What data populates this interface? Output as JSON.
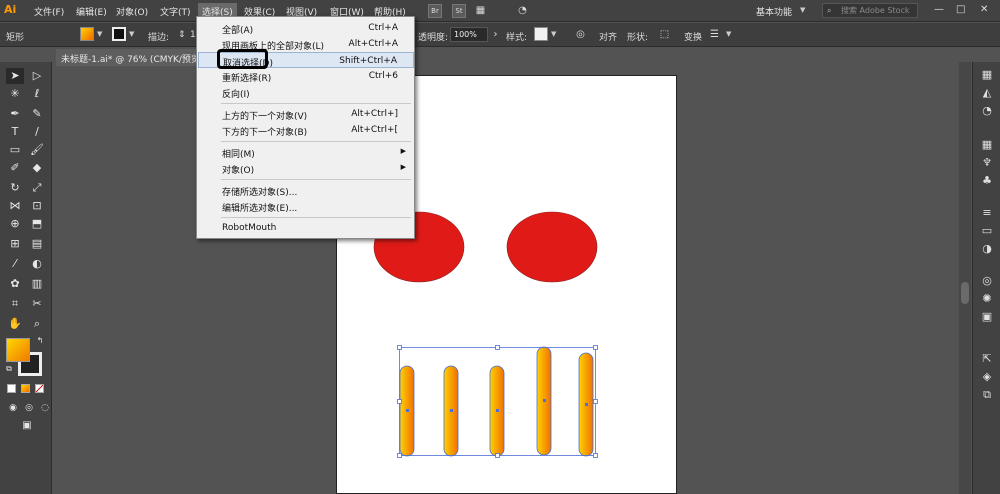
{
  "app": {
    "logo": "Ai",
    "workspace": "基本功能",
    "search_placeholder": "搜索 Adobe Stock"
  },
  "menubar": {
    "items": [
      "文件(F)",
      "编辑(E)",
      "对象(O)",
      "文字(T)",
      "选择(S)",
      "效果(C)",
      "视图(V)",
      "窗口(W)",
      "帮助(H)"
    ],
    "icons": [
      "Br",
      "St"
    ]
  },
  "control": {
    "tool_name": "矩形",
    "stroke_label": "描边:",
    "stroke_value": "1",
    "opacity_label": "透明度:",
    "opacity_value": "100%",
    "style_label": "样式:",
    "align_label": "对齐",
    "shape_label": "形状:",
    "transform_label": "变换"
  },
  "document": {
    "tab_title": "未标题-1.ai* @ 76% (CMYK/预览)"
  },
  "select_menu": {
    "items": [
      {
        "label": "全部(A)",
        "shortcut": "Ctrl+A"
      },
      {
        "label": "现用画板上的全部对象(L)",
        "shortcut": "Alt+Ctrl+A"
      },
      {
        "label": "取消选择(D)",
        "shortcut": "Shift+Ctrl+A"
      },
      {
        "label": "重新选择(R)",
        "shortcut": "Ctrl+6"
      },
      {
        "label": "反向(I)",
        "shortcut": ""
      },
      {
        "label": "上方的下一个对象(V)",
        "shortcut": "Alt+Ctrl+]"
      },
      {
        "label": "下方的下一个对象(B)",
        "shortcut": "Alt+Ctrl+["
      },
      {
        "label": "相同(M)",
        "shortcut": ""
      },
      {
        "label": "对象(O)",
        "shortcut": ""
      },
      {
        "label": "存储所选对象(S)...",
        "shortcut": ""
      },
      {
        "label": "编辑所选对象(E)...",
        "shortcut": ""
      },
      {
        "label": "RobotMouth",
        "shortcut": ""
      }
    ]
  },
  "colors": {
    "eye_red": "#e01b17",
    "fill_gradient_start": "#ffd200",
    "fill_gradient_end": "#f06a00",
    "selection_blue": "#4a6fd8"
  }
}
